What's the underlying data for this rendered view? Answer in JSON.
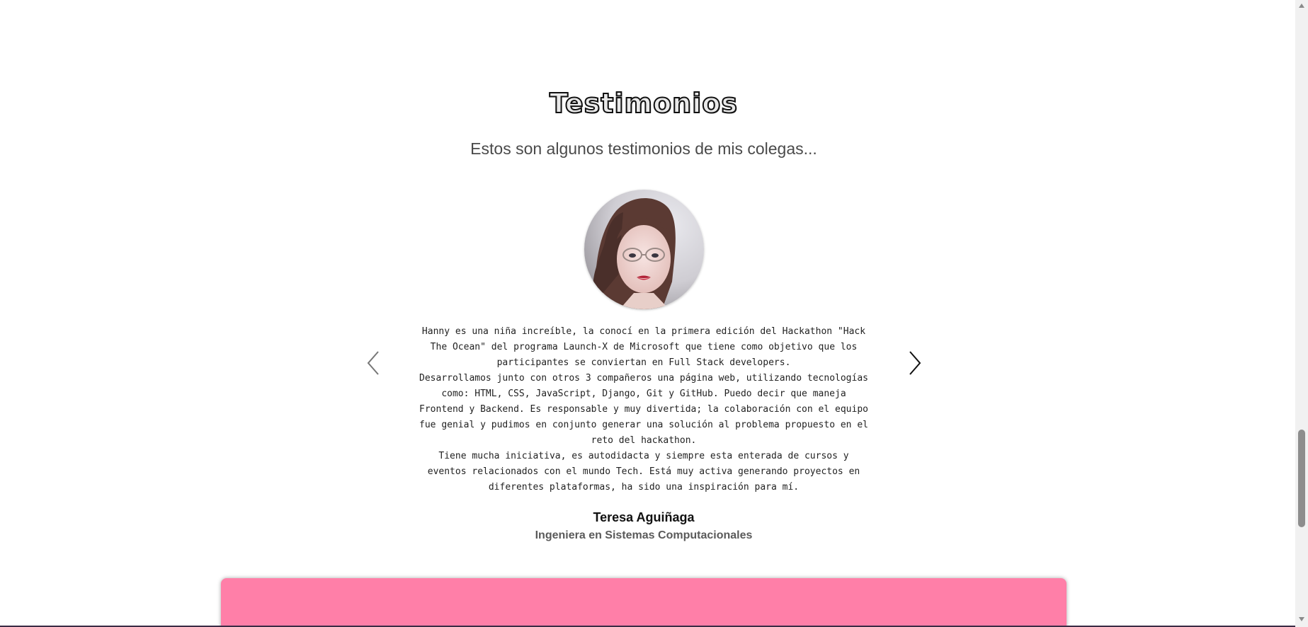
{
  "testimonials": {
    "title": "Testimonios",
    "subtitle": "Estos son algunos testimonios de mis colegas...",
    "current": {
      "quote_paragraphs": [
        "Hanny es una niña increíble, la conocí en la primera edición del Hackathon \"Hack The Ocean\" del programa Launch-X de Microsoft que tiene como objetivo que los participantes se conviertan en Full Stack developers.",
        "Desarrollamos junto con otros 3 compañeros una página web, utilizando tecnologías como: HTML, CSS, JavaScript, Django, Git y GitHub. Puedo decir que maneja Frontend y Backend. Es responsable y muy divertida; la colaboración con el equipo fue genial y pudimos en conjunto generar una solución al problema propuesto en el reto del hackathon.",
        "Tiene mucha iniciativa, es autodidacta y siempre esta enterada de cursos y eventos relacionados con el mundo Tech. Está muy activa generando proyectos en diferentes plataformas, ha sido una inspiración para mí."
      ],
      "author_name": "Teresa Aguiñaga",
      "author_role": "Ingeniera en Sistemas Computacionales"
    },
    "controls": {
      "prev_icon": "chevron-left-icon",
      "next_icon": "chevron-right-icon"
    }
  },
  "colors": {
    "card_accent": "#ff7fa8",
    "subtitle_text": "#4a4a4a",
    "role_text": "#5a5a5a"
  }
}
